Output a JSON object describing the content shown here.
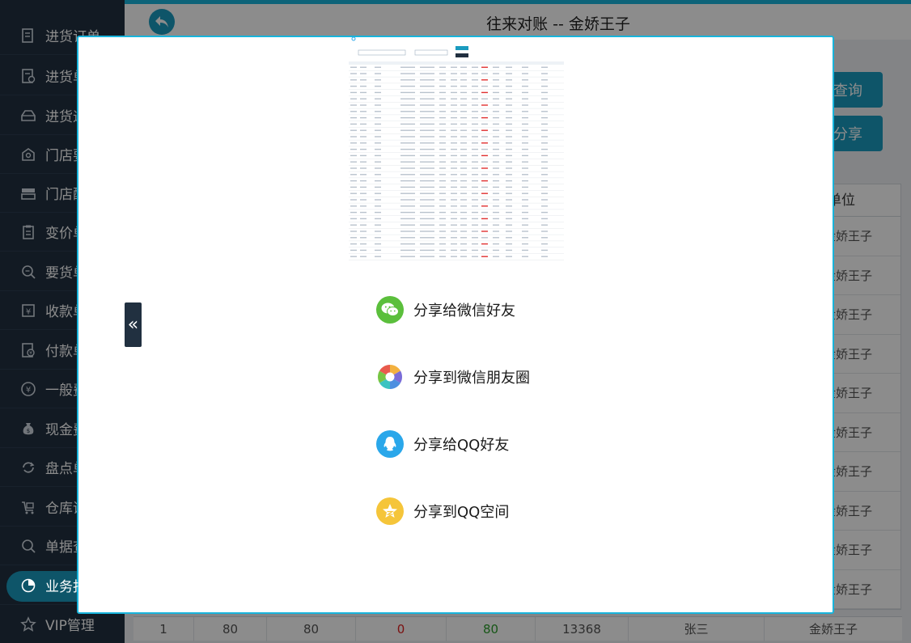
{
  "header": {
    "title": "往来对账 -- 金娇王子"
  },
  "sidebar": {
    "items": [
      {
        "label": "进货订单",
        "icon": "doc-icon"
      },
      {
        "label": "进货单",
        "icon": "doc-icon"
      },
      {
        "label": "进货退",
        "icon": "box-icon"
      },
      {
        "label": "门店要",
        "icon": "store-icon"
      },
      {
        "label": "门店配",
        "icon": "truck-icon"
      },
      {
        "label": "变价单",
        "icon": "clipboard-icon"
      },
      {
        "label": "要货单",
        "icon": "search-doc-icon"
      },
      {
        "label": "收款单",
        "icon": "yen-box-icon"
      },
      {
        "label": "付款单",
        "icon": "yen-doc-icon"
      },
      {
        "label": "一般费",
        "icon": "yen-circle-icon"
      },
      {
        "label": "现金费",
        "icon": "money-bag-icon"
      },
      {
        "label": "盘点单",
        "icon": "refresh-icon"
      },
      {
        "label": "仓库调",
        "icon": "cart-icon"
      },
      {
        "label": "单据查",
        "icon": "search-icon"
      },
      {
        "label": "业务报",
        "icon": "pie-chart-icon"
      },
      {
        "label": "VIP管理",
        "icon": "star-icon"
      }
    ]
  },
  "toolbar": {
    "query_label": "查询",
    "share_label": "分享"
  },
  "table": {
    "last_col_header": "单位",
    "row_value": "金娇王子",
    "last_row": [
      "1",
      "80",
      "80",
      "0",
      "80",
      "13368",
      "张三",
      "金娇王子"
    ]
  },
  "share_menu": {
    "items": [
      {
        "label": "分享给微信好友",
        "icon": "wechat-icon",
        "color": "#5bbf3c"
      },
      {
        "label": "分享到微信朋友圈",
        "icon": "moments-icon",
        "color": "#ffffff"
      },
      {
        "label": "分享给QQ好友",
        "icon": "qq-icon",
        "color": "#2aa7ea"
      },
      {
        "label": "分享到QQ空间",
        "icon": "qzone-icon",
        "color": "#f5c53a"
      }
    ]
  },
  "colors": {
    "accent": "#1a9bbf",
    "sidebar": "#213040",
    "positive": "#2a9d2a",
    "negative": "#e02020"
  }
}
